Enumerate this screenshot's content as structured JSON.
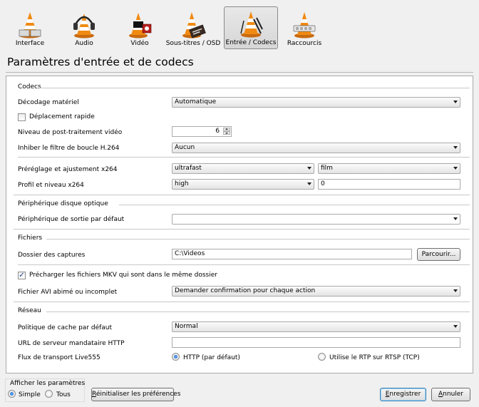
{
  "toolbar": {
    "items": [
      {
        "label": "Interface",
        "icon": "vlc-cone-interface-icon"
      },
      {
        "label": "Audio",
        "icon": "vlc-cone-headphones-icon"
      },
      {
        "label": "Vidéo",
        "icon": "vlc-cone-video-icon"
      },
      {
        "label": "Sous-titres / OSD",
        "icon": "vlc-cone-subtitles-icon"
      },
      {
        "label": "Entrée / Codecs",
        "icon": "vlc-cone-codecs-icon"
      },
      {
        "label": "Raccourcis",
        "icon": "vlc-cone-hotkeys-icon"
      }
    ],
    "active_index": 4
  },
  "page_title": "Paramètres d'entrée et de codecs",
  "codecs": {
    "title": "Codecs",
    "hw_decoding_label": "Décodage matériel",
    "hw_decoding_value": "Automatique",
    "fast_seek_label": "Déplacement rapide",
    "fast_seek_checked": false,
    "postproc_label": "Niveau de post-traitement vidéo",
    "postproc_value": "6",
    "loop_filter_label": "Inhiber le filtre de boucle H.264",
    "loop_filter_value": "Aucun",
    "x264_preset_label": "Préréglage et ajustement x264",
    "x264_preset_value": "ultrafast",
    "x264_tune_value": "film",
    "x264_profile_label": "Profil et niveau x264",
    "x264_profile_value": "high",
    "x264_level_value": "0"
  },
  "optical": {
    "title": "Périphérique disque optique",
    "device_label": "Périphérique de sortie par défaut",
    "device_value": ""
  },
  "files": {
    "title": "Fichiers",
    "record_dir_label": "Dossier des captures",
    "record_dir_value": "C:\\Videos",
    "browse_label": "Parcourir...",
    "mkv_preload_label": "Précharger les fichiers MKV qui sont dans le même dossier",
    "mkv_preload_checked": true,
    "avi_label": "Fichier AVI abimé ou incomplet",
    "avi_value": "Demander confirmation pour chaque action"
  },
  "network": {
    "title": "Réseau",
    "cache_label": "Politique de cache par défaut",
    "cache_value": "Normal",
    "proxy_label": "URL de serveur mandataire HTTP",
    "proxy_value": "",
    "live555_label": "Flux de transport Live555",
    "live555_http_label": "HTTP (par défaut)",
    "live555_rtp_label": "Utilise le RTP sur RTSP (TCP)",
    "live555_selected": "http"
  },
  "footer": {
    "show_settings_label": "Afficher les paramètres",
    "simple_label": "Simple",
    "all_label": "Tous",
    "selected": "simple",
    "reset_prefix": "",
    "reset_label": "Réinitialiser les préférences",
    "save_label": "Enregistrer",
    "cancel_label": "Annuler"
  },
  "colors": {
    "cone_orange": "#f08a12",
    "accent_blue": "#3c7fb1",
    "panel_bg": "#ffffff",
    "window_bg": "#f0f0f0"
  }
}
